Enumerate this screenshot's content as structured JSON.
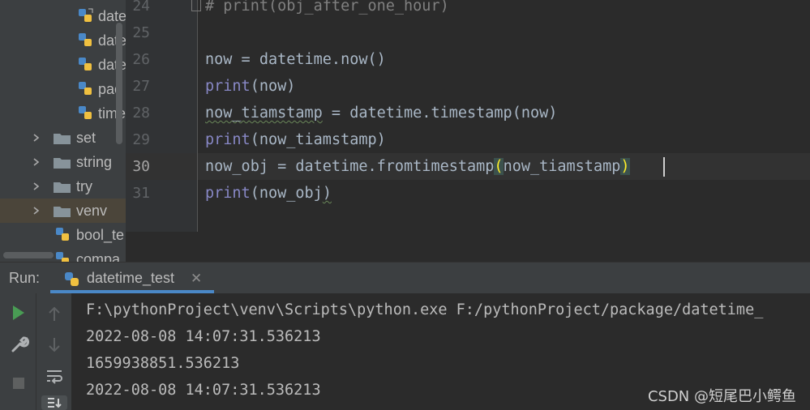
{
  "project_tree": {
    "items": [
      {
        "label": "date",
        "type": "py"
      },
      {
        "label": "date",
        "type": "py"
      },
      {
        "label": "date",
        "type": "py"
      },
      {
        "label": "pac",
        "type": "py"
      },
      {
        "label": "time",
        "type": "py"
      },
      {
        "label": "set",
        "type": "folder"
      },
      {
        "label": "string",
        "type": "folder"
      },
      {
        "label": "try",
        "type": "folder"
      },
      {
        "label": "venv",
        "type": "folder"
      },
      {
        "label": "bool_te",
        "type": "py"
      },
      {
        "label": "compa",
        "type": "py"
      }
    ]
  },
  "editor": {
    "lines": [
      {
        "number": "24",
        "text": "# print(obj_after_one_hour)"
      },
      {
        "number": "25",
        "text": ""
      },
      {
        "number": "26",
        "text": "now = datetime.now()"
      },
      {
        "number": "27",
        "text": "print(now)"
      },
      {
        "number": "28",
        "text": "now_tiamstamp = datetime.timestamp(now)"
      },
      {
        "number": "29",
        "text": "print(now_tiamstamp)"
      },
      {
        "number": "30",
        "text": "now_obj = datetime.fromtimestamp(now_tiamstamp)"
      },
      {
        "number": "31",
        "text": "print(now_obj)"
      }
    ],
    "current_line": "30",
    "tokens": {
      "l24": "# print(obj_after_one_hour)",
      "l26": "now = datetime.now()",
      "l27_fn": "print",
      "l27_rest": "(now)",
      "l28_var": "now_tiamstamp",
      "l28_rest": " = datetime.timestamp(now)",
      "l29_fn": "print",
      "l29_rest": "(now_tiamstamp)",
      "l30_pre": "now_obj = datetime.fromtimestamp",
      "l30_open": "(",
      "l30_arg": "now_tiamstamp",
      "l30_close": ")",
      "l31_fn": "print",
      "l31_arg": "(now_obj",
      "l31_close": ")"
    }
  },
  "run_panel": {
    "label": "Run:",
    "tab_label": "datetime_test",
    "close_glyph": "✕",
    "output": [
      "F:\\pythonProject\\venv\\Scripts\\python.exe F:/pythonProject/package/datetime_",
      "2022-08-08 14:07:31.536213",
      "1659938851.536213",
      "2022-08-08 14:07:31.536213"
    ]
  },
  "watermark": "CSDN @短尾巴小鳄鱼",
  "colors": {
    "run_green": "#499c54",
    "tab_underline": "#4a88c7",
    "keyword_builtin": "#8888c6",
    "paren_highlight": "#ffef28"
  }
}
